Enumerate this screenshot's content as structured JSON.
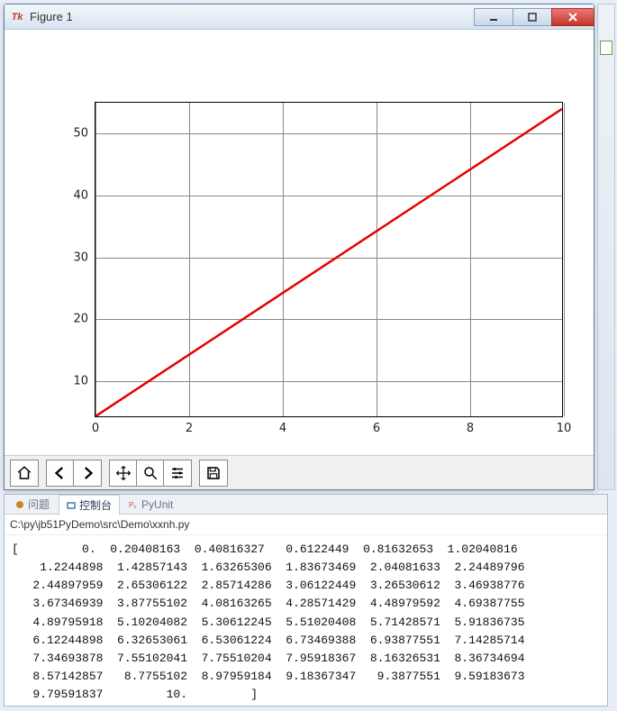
{
  "window": {
    "title": "Figure 1",
    "min_label": "Minimize",
    "max_label": "Maximize",
    "close_label": "Close"
  },
  "chart_data": {
    "type": "line",
    "x": [
      0,
      10
    ],
    "y": [
      4,
      54
    ],
    "xlim": [
      0,
      10
    ],
    "ylim": [
      4,
      55
    ],
    "xticks": [
      0,
      2,
      4,
      6,
      8,
      10
    ],
    "yticks": [
      10,
      20,
      30,
      40,
      50
    ],
    "color": "#e60000",
    "title": "",
    "xlabel": "",
    "ylabel": "",
    "grid": true
  },
  "toolbar": {
    "home": "Home",
    "back": "Back",
    "forward": "Forward",
    "pan": "Pan",
    "zoom": "Zoom",
    "config": "Configure subplots",
    "save": "Save figure"
  },
  "console": {
    "tabs": {
      "problems": "问题",
      "console": "控制台",
      "pyunit": "PyUnit"
    },
    "path": "C:\\py\\jb51PyDemo\\src\\Demo\\xxnh.py",
    "output_values": [
      "0.",
      "0.20408163",
      "0.40816327",
      "0.6122449",
      "0.81632653",
      "1.02040816",
      "1.2244898",
      "1.42857143",
      "1.63265306",
      "1.83673469",
      "2.04081633",
      "2.24489796",
      "2.44897959",
      "2.65306122",
      "2.85714286",
      "3.06122449",
      "3.26530612",
      "3.46938776",
      "3.67346939",
      "3.87755102",
      "4.08163265",
      "4.28571429",
      "4.48979592",
      "4.69387755",
      "4.89795918",
      "5.10204082",
      "5.30612245",
      "5.51020408",
      "5.71428571",
      "5.91836735",
      "6.12244898",
      "6.32653061",
      "6.53061224",
      "6.73469388",
      "6.93877551",
      "7.14285714",
      "7.34693878",
      "7.55102041",
      "7.75510204",
      "7.95918367",
      "8.16326531",
      "8.36734694",
      "8.57142857",
      "8.7755102",
      "8.97959184",
      "9.18367347",
      "9.3877551",
      "9.59183673",
      "9.79591837",
      "10."
    ]
  }
}
